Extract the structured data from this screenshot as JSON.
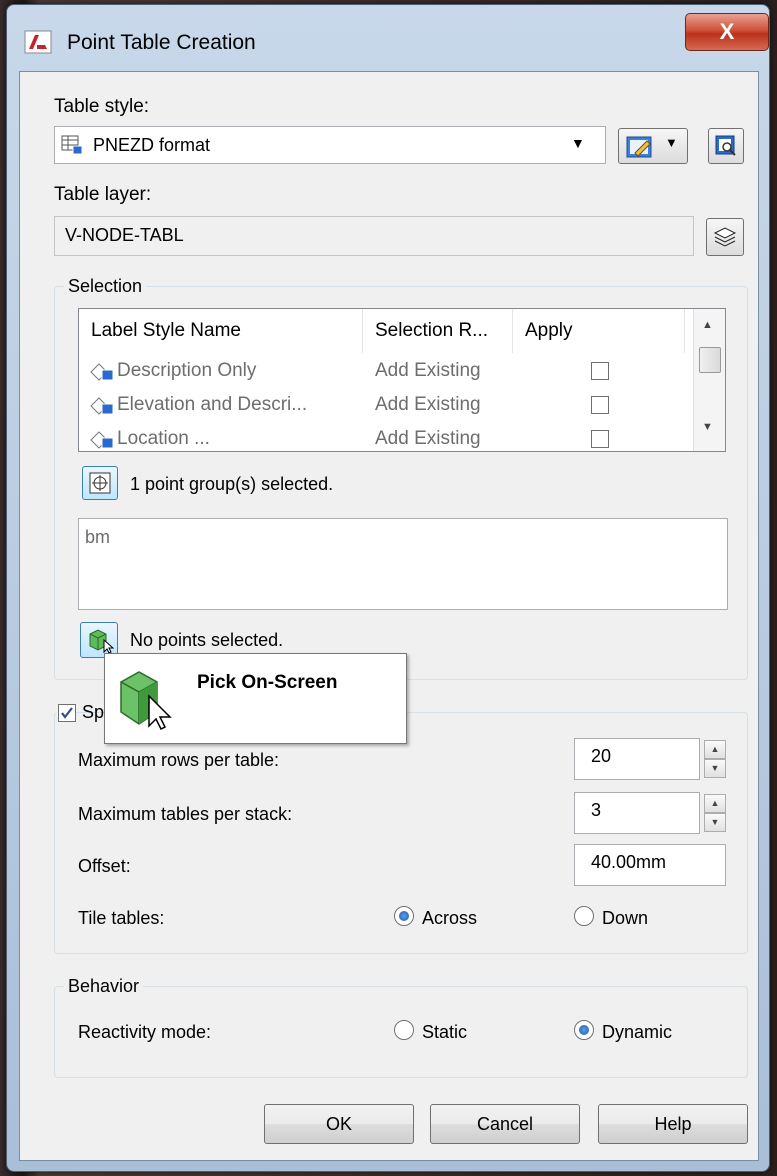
{
  "window": {
    "title": "Point Table Creation",
    "close_glyph": "X"
  },
  "table_style": {
    "label": "Table style:",
    "value": "PNEZD format"
  },
  "table_layer": {
    "label": "Table layer:",
    "value": "V-NODE-TABL"
  },
  "selection": {
    "group_label": "Selection",
    "columns": [
      "Label Style Name",
      "Selection R...",
      "Apply"
    ],
    "rows": [
      {
        "name": "Description Only",
        "selection": "Add Existing",
        "apply": false
      },
      {
        "name": "Elevation and Descri...",
        "selection": "Add Existing",
        "apply": false
      },
      {
        "name": "Location ...",
        "selection": "Add Existing",
        "apply": false
      }
    ],
    "point_groups_status": "1 point group(s) selected.",
    "point_groups_text": "bm",
    "points_status": "No points selected."
  },
  "tooltip": {
    "text": "Pick On-Screen"
  },
  "split": {
    "checkbox_label": "Split table",
    "checked": true,
    "max_rows_label": "Maximum rows per table:",
    "max_rows_value": "20",
    "max_tables_label": "Maximum tables per stack:",
    "max_tables_value": "3",
    "offset_label": "Offset:",
    "offset_value": "40.00mm",
    "tile_label": "Tile tables:",
    "tile_across": "Across",
    "tile_down": "Down",
    "tile_selected": "Across"
  },
  "behavior": {
    "group_label": "Behavior",
    "reactivity_label": "Reactivity mode:",
    "static": "Static",
    "dynamic": "Dynamic",
    "selected": "Dynamic"
  },
  "buttons": {
    "ok": "OK",
    "cancel": "Cancel",
    "help": "Help"
  },
  "icons": [
    "autocad-app-icon",
    "table-style-icon",
    "edit-style-icon",
    "dropdown-arrow-icon",
    "preview-style-icon",
    "layer-icon",
    "label-style-icon",
    "point-group-select-icon",
    "pick-points-icon",
    "cursor-arrow-icon"
  ]
}
